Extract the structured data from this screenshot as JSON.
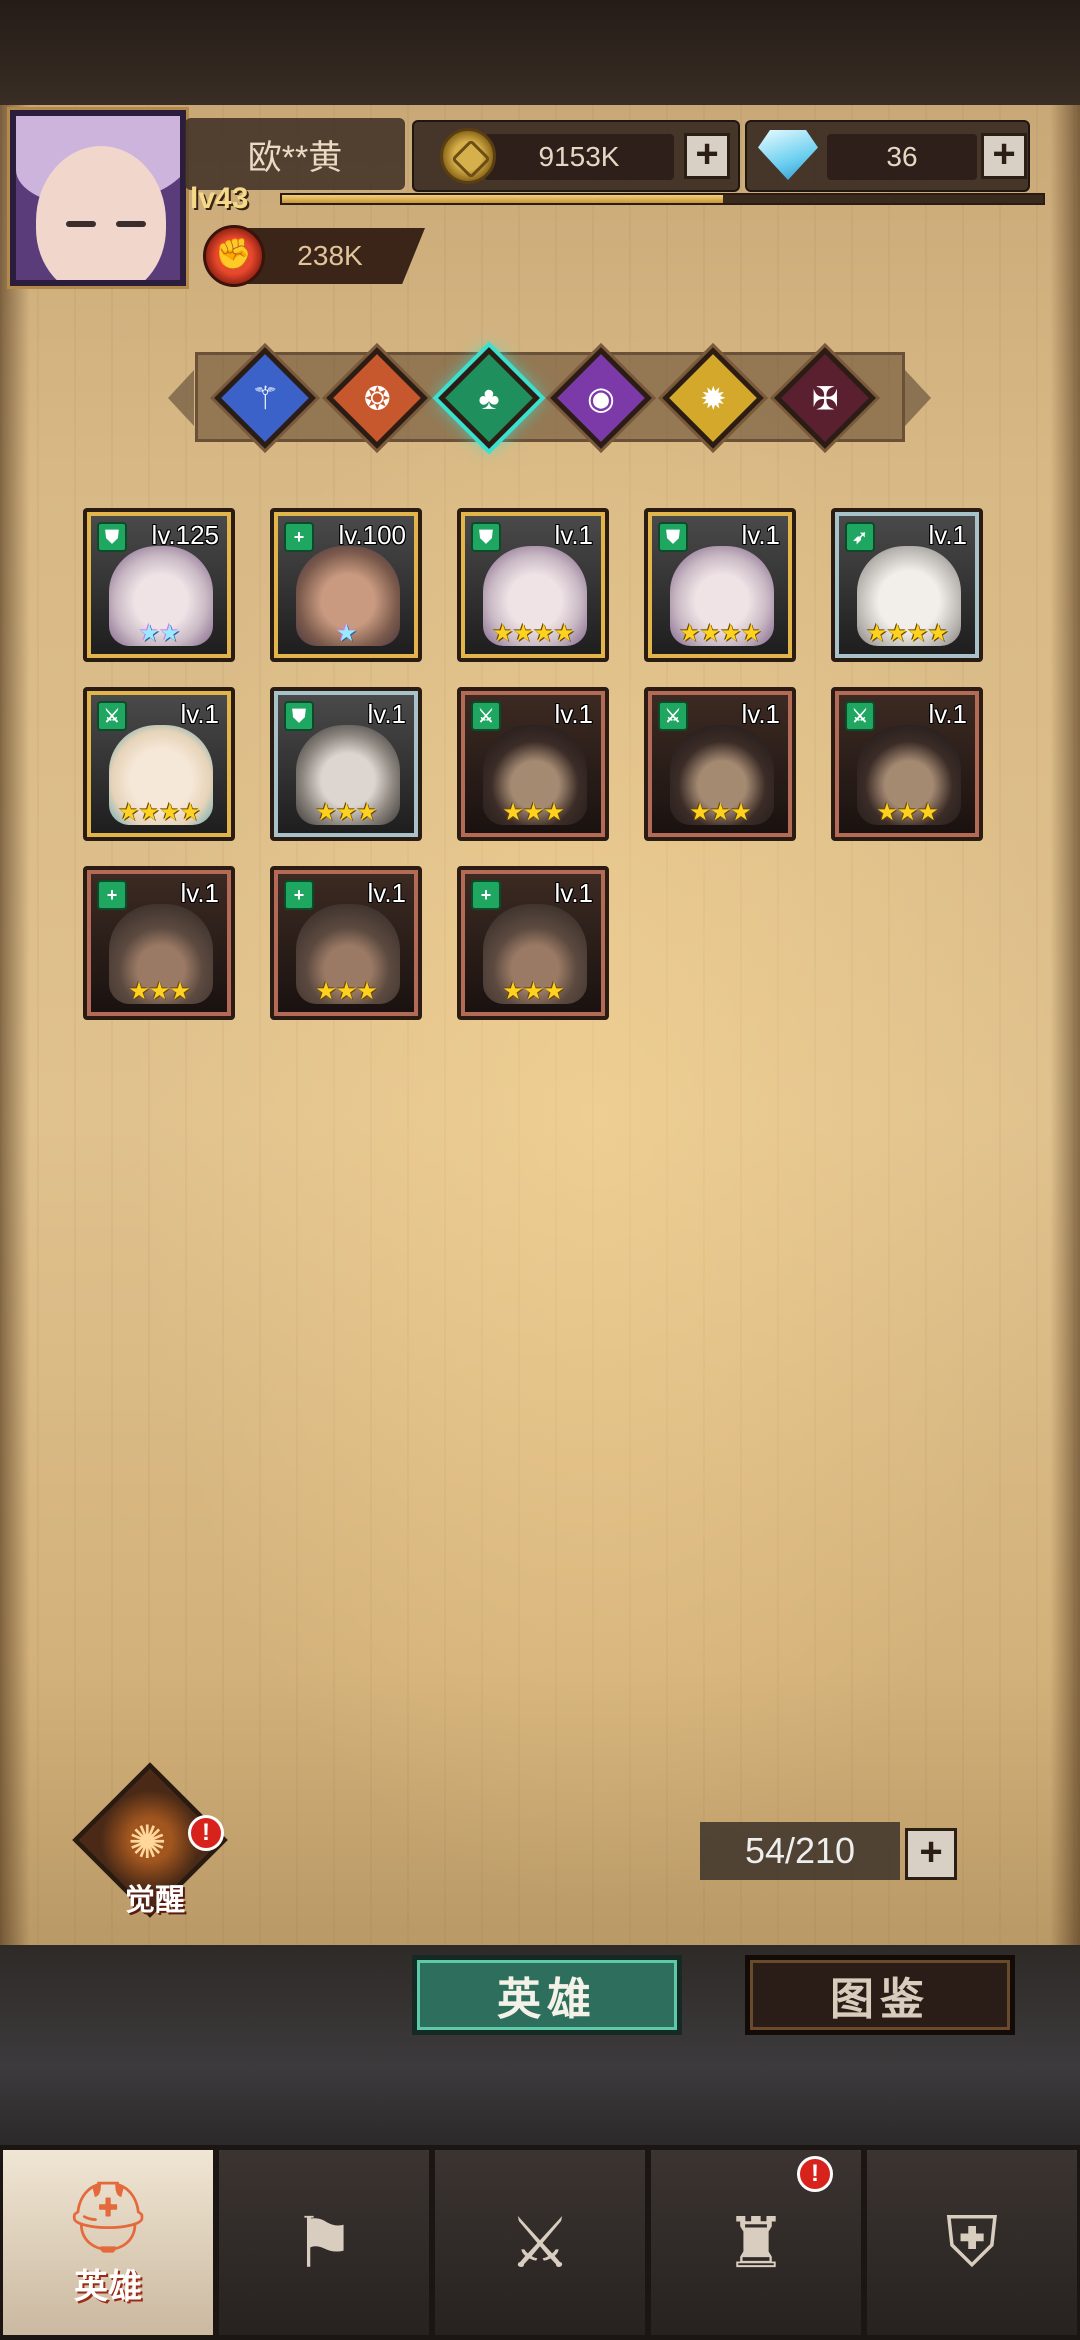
{
  "player": {
    "name": "欧**黄",
    "level": "lv43",
    "power": "238K",
    "exp_progress": 0.58
  },
  "resources": {
    "gold": "9153K",
    "gems": "36"
  },
  "factions": [
    {
      "name": "tech",
      "color": "#3a62c9"
    },
    {
      "name": "chaos",
      "color": "#c7572c"
    },
    {
      "name": "nature",
      "color": "#1f8f5d",
      "active": true
    },
    {
      "name": "mystic",
      "color": "#7c3aa8"
    },
    {
      "name": "holy",
      "color": "#d4a82a"
    },
    {
      "name": "dark",
      "color": "#5a2030"
    }
  ],
  "heroes": [
    {
      "level": "lv.125",
      "stars": "★★",
      "rainbow": true,
      "frame": "gold",
      "class": "shield",
      "portrait": "lady"
    },
    {
      "level": "lv.100",
      "stars": "★",
      "rainbow": true,
      "frame": "gold",
      "class": "heal",
      "portrait": "man"
    },
    {
      "level": "lv.1",
      "stars": "★★★★",
      "rainbow": false,
      "frame": "gold",
      "class": "shield",
      "portrait": "lady"
    },
    {
      "level": "lv.1",
      "stars": "★★★★",
      "rainbow": false,
      "frame": "gold",
      "class": "shield",
      "portrait": "lady"
    },
    {
      "level": "lv.1",
      "stars": "★★★★",
      "rainbow": false,
      "frame": "silver",
      "class": "bow",
      "portrait": "white"
    },
    {
      "level": "lv.1",
      "stars": "★★★★",
      "rainbow": false,
      "frame": "gold",
      "class": "sword",
      "portrait": "blond"
    },
    {
      "level": "lv.1",
      "stars": "★★★",
      "rainbow": false,
      "frame": "silver",
      "class": "shield",
      "portrait": "vamp"
    },
    {
      "level": "lv.1",
      "stars": "★★★",
      "rainbow": false,
      "frame": "bronze",
      "class": "sword",
      "portrait": "hood"
    },
    {
      "level": "lv.1",
      "stars": "★★★",
      "rainbow": false,
      "frame": "bronze",
      "class": "sword",
      "portrait": "hood"
    },
    {
      "level": "lv.1",
      "stars": "★★★",
      "rainbow": false,
      "frame": "bronze",
      "class": "sword",
      "portrait": "hood"
    },
    {
      "level": "lv.1",
      "stars": "★★★",
      "rainbow": false,
      "frame": "bronze",
      "class": "heal",
      "portrait": "helm"
    },
    {
      "level": "lv.1",
      "stars": "★★★",
      "rainbow": false,
      "frame": "bronze",
      "class": "heal",
      "portrait": "helm"
    },
    {
      "level": "lv.1",
      "stars": "★★★",
      "rainbow": false,
      "frame": "bronze",
      "class": "heal",
      "portrait": "helm"
    }
  ],
  "awaken": {
    "label": "觉醒",
    "alert": "!"
  },
  "hero_count": "54/210",
  "tabs": {
    "heroes": "英雄",
    "codex": "图鉴"
  },
  "bottom_nav": [
    {
      "label": "英雄",
      "icon": "helmet-icon",
      "active": true
    },
    {
      "label": "",
      "icon": "map-flag-icon",
      "active": false
    },
    {
      "label": "",
      "icon": "battle-icon",
      "active": false
    },
    {
      "label": "",
      "icon": "castle-icon",
      "active": false,
      "alert": "!"
    },
    {
      "label": "",
      "icon": "guild-icon",
      "active": false
    }
  ]
}
